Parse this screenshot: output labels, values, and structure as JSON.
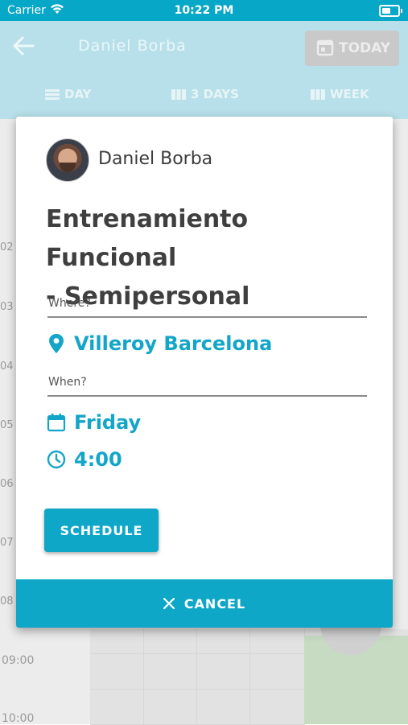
{
  "status_bar": {
    "carrier": "Carrier",
    "time": "10:22 PM"
  },
  "header": {
    "title": "Daniel Borba",
    "today_label": "TODAY"
  },
  "view_tabs": [
    {
      "label": "DAY",
      "icon": "day-view-icon"
    },
    {
      "label": "3 DAYS",
      "icon": "three-days-view-icon"
    },
    {
      "label": "WEEK",
      "icon": "week-view-icon"
    }
  ],
  "calendar": {
    "hours": [
      "02",
      "03",
      "04",
      "05",
      "06",
      "07",
      "08",
      "09:00",
      "10:00"
    ]
  },
  "dialog": {
    "person_name": "Daniel Borba",
    "event_title_line1": "Entrenamiento Funcional",
    "event_title_line2": "- Semipersonal",
    "where_label": "Where?",
    "location": "Villeroy Barcelona",
    "when_label": "When?",
    "day": "Friday",
    "time": "4:00",
    "schedule_label": "SCHEDULE",
    "cancel_label": "CANCEL"
  },
  "colors": {
    "accent": "#0ea7c8",
    "status_bar": "#07a7c7"
  }
}
